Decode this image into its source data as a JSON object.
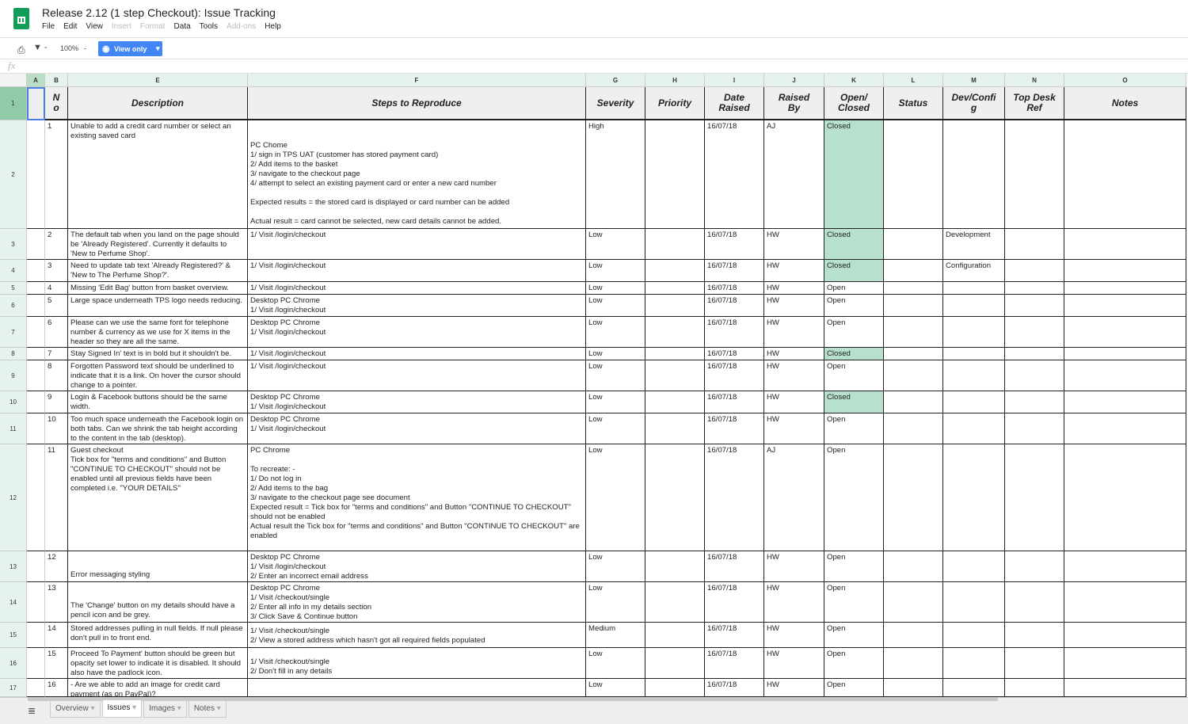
{
  "app": {
    "title": "Release 2.12 (1 step Checkout): Issue Tracking",
    "menu": [
      {
        "label": "File",
        "enabled": true
      },
      {
        "label": "Edit",
        "enabled": true
      },
      {
        "label": "View",
        "enabled": true
      },
      {
        "label": "Insert",
        "enabled": false
      },
      {
        "label": "Format",
        "enabled": false
      },
      {
        "label": "Data",
        "enabled": true
      },
      {
        "label": "Tools",
        "enabled": true
      },
      {
        "label": "Add-ons",
        "enabled": false
      },
      {
        "label": "Help",
        "enabled": true
      }
    ]
  },
  "toolbar": {
    "zoom": "100%",
    "view_only": "View only",
    "fx": "fx"
  },
  "columns": [
    "A",
    "B",
    "E",
    "F",
    "G",
    "H",
    "I",
    "J",
    "K",
    "L",
    "M",
    "N",
    "O"
  ],
  "headers": [
    "",
    "N\no",
    "Description",
    "Steps to Reproduce",
    "Severity",
    "Priority",
    "Date\nRaised",
    "Raised\nBy",
    "Open/\nClosed",
    "Status",
    "Dev/Confi\ng",
    "Top Desk\nRef",
    "Notes"
  ],
  "rows": [
    {
      "n": "2",
      "no": "1",
      "desc": "Unable to add a credit card number or select an existing saved card",
      "steps": "\nPC Chome\n1/ sign in TPS UAT (customer has stored payment card)\n2/ Add items to the basket\n3/ navigate to the checkout page\n4/ attempt to select an existing payment card or enter a new card number\n\nExpected results = the stored card is displayed or card number can be added\n\nActual result = card cannot be selected, new card details cannot be added.",
      "severity": "High",
      "date": "16/07/18",
      "by": "AJ",
      "oc": "Closed",
      "dev": ""
    },
    {
      "n": "3",
      "no": "2",
      "desc": "The default tab when you land on the page should be 'Already Registered'. Currently it defaults to 'New to Perfume Shop'.",
      "steps": "1/ Visit /login/checkout",
      "severity": "Low",
      "date": "16/07/18",
      "by": "HW",
      "oc": "Closed",
      "dev": "Development"
    },
    {
      "n": "4",
      "no": "3",
      "desc": "Need to update tab text 'Already Registered?' & 'New to The Perfume Shop?'.",
      "steps": "1/ Visit /login/checkout",
      "severity": "Low",
      "date": "16/07/18",
      "by": "HW",
      "oc": "Closed",
      "dev": "Configuration"
    },
    {
      "n": "5",
      "no": "4",
      "desc": "Missing 'Edit Bag' button from basket overview.",
      "steps": "1/ Visit /login/checkout",
      "severity": "Low",
      "date": "16/07/18",
      "by": "HW",
      "oc": "Open",
      "dev": ""
    },
    {
      "n": "6",
      "no": "5",
      "desc": "Large space underneath TPS logo needs reducing.",
      "steps": "Desktop PC Chrome\n1/ Visit /login/checkout",
      "severity": "Low",
      "date": "16/07/18",
      "by": "HW",
      "oc": "Open",
      "dev": ""
    },
    {
      "n": "7",
      "no": "6",
      "desc": "Please can we use the same font for telephone number & currency as we use for X items in the header so they are all the same.",
      "steps": "Desktop PC Chrome\n1/ Visit /login/checkout",
      "severity": "Low",
      "date": "16/07/18",
      "by": "HW",
      "oc": "Open",
      "dev": ""
    },
    {
      "n": "8",
      "no": "7",
      "desc": "Stay Signed In' text is in bold but it shouldn't be.",
      "steps": "1/ Visit /login/checkout",
      "severity": "Low",
      "date": "16/07/18",
      "by": "HW",
      "oc": "Closed",
      "dev": ""
    },
    {
      "n": "9",
      "no": "8",
      "desc": "Forgotten Password text should be underlined to indicate that it is a link. On hover the cursor should change to a pointer.",
      "steps": "1/ Visit /login/checkout",
      "severity": "Low",
      "date": "16/07/18",
      "by": "HW",
      "oc": "Open",
      "dev": ""
    },
    {
      "n": "10",
      "no": "9",
      "desc": "Login & Facebook buttons should be the same width.",
      "steps": "Desktop PC Chrome\n1/ Visit /login/checkout",
      "severity": "Low",
      "date": "16/07/18",
      "by": "HW",
      "oc": "Closed",
      "dev": ""
    },
    {
      "n": "11",
      "no": "10",
      "desc": "Too much space underneath the Facebook login on both tabs. Can we shrink the tab height according to the content in the tab (desktop).",
      "steps": "Desktop PC Chrome\n1/ Visit /login/checkout",
      "severity": "Low",
      "date": "16/07/18",
      "by": "HW",
      "oc": "Open",
      "dev": ""
    },
    {
      "n": "12",
      "no": "11",
      "desc": "Guest checkout\nTick box for \"terms and conditions\" and Button \"CONTINUE TO CHECKOUT\" should not be enabled until all previous fields have been completed i.e. \"YOUR DETAILS\"",
      "steps": "PC Chrome\n\nTo recreate: -\n1/ Do not log in\n2/ Add items to the bag\n3/ navigate to the checkout page see document\nExpected result = Tick box for \"terms and conditions\" and Button \"CONTINUE TO CHECKOUT\" should not be enabled\nActual result the Tick box for \"terms and conditions\" and Button \"CONTINUE TO CHECKOUT\" are enabled",
      "severity": "Low",
      "date": "16/07/18",
      "by": "AJ",
      "oc": "Open",
      "dev": ""
    },
    {
      "n": "13",
      "no": "12",
      "desc": "Error messaging styling",
      "steps": "Desktop PC Chrome\n1/ Visit /login/checkout\n2/ Enter an incorrect email address",
      "severity": "Low",
      "date": "16/07/18",
      "by": "HW",
      "oc": "Open",
      "dev": ""
    },
    {
      "n": "14",
      "no": "13",
      "desc": "The 'Change' button on my details should have a pencil icon and be grey.",
      "steps": "Desktop PC Chrome\n1/ Visit /checkout/single\n2/ Enter all info in my details section\n3/ Click Save & Continue button",
      "severity": "Low",
      "date": "16/07/18",
      "by": "HW",
      "oc": "Open",
      "dev": ""
    },
    {
      "n": "15",
      "no": "14",
      "desc": "Stored addresses pulling in null fields. If null please don't pull in to front end.",
      "steps": "1/ Visit /checkout/single\n2/ View a stored address which hasn't got all required fields populated",
      "severity": "Medium",
      "date": "16/07/18",
      "by": "HW",
      "oc": "Open",
      "dev": ""
    },
    {
      "n": "16",
      "no": "15",
      "desc": "Proceed To Payment' button should be green but opacity set lower to indicate it is disabled. It should also have the padlock icon.",
      "steps": "1/ Visit /checkout/single\n2/ Don't fill in any details",
      "severity": "Low",
      "date": "16/07/18",
      "by": "HW",
      "oc": "Open",
      "dev": ""
    },
    {
      "n": "17",
      "no": "16",
      "desc": "- Are we able to add an image for credit card payment (as on PayPal)?",
      "steps": "",
      "severity": "Low",
      "date": "16/07/18",
      "by": "HW",
      "oc": "Open",
      "dev": ""
    }
  ],
  "sheets": [
    {
      "label": "Overview",
      "active": false
    },
    {
      "label": "Issues",
      "active": true
    },
    {
      "label": "Images",
      "active": false
    },
    {
      "label": "Notes",
      "active": false
    }
  ],
  "colors": {
    "closed": "#b7e1cd",
    "accent": "#4285f4",
    "brand": "#0f9d58"
  }
}
